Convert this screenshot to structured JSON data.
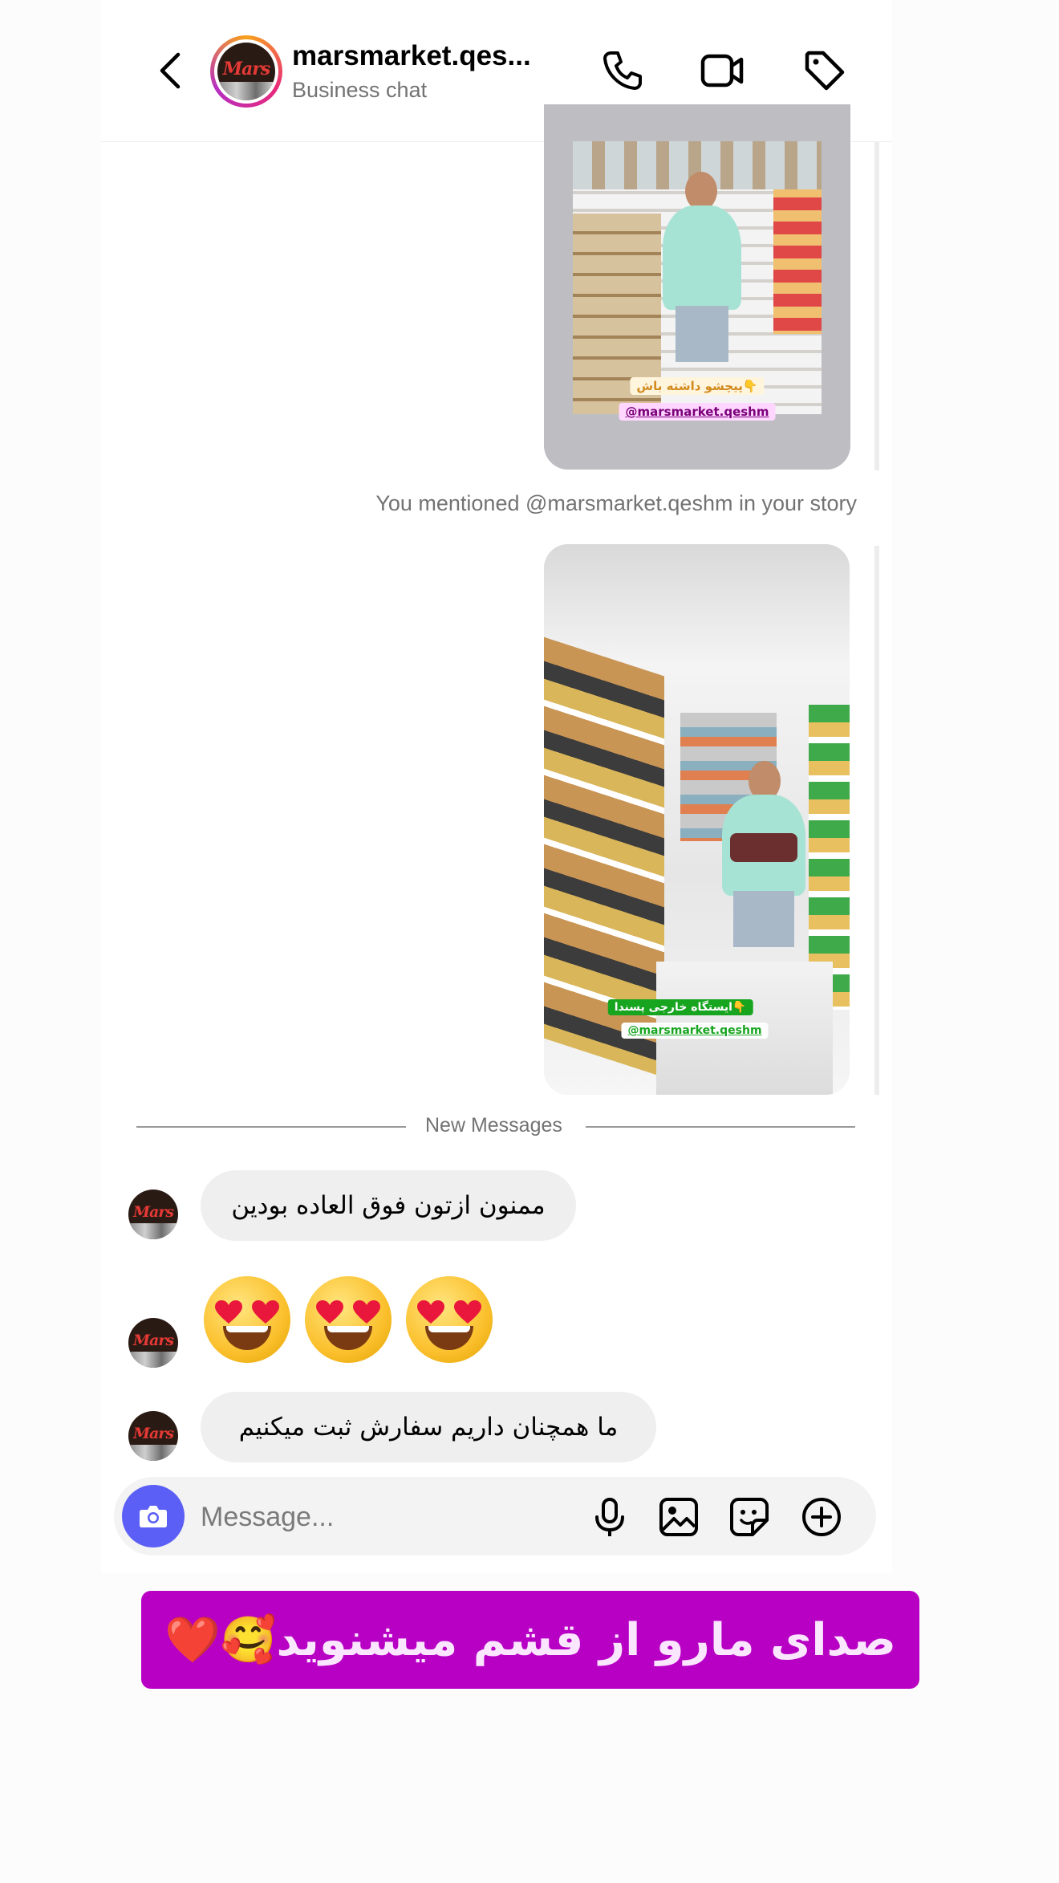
{
  "header": {
    "title": "marsmarket.qes...",
    "subtitle": "Business chat",
    "avatar_logo_text": "Mars"
  },
  "stories": [
    {
      "sticker_text": "پیچشو داشته باش👇",
      "mention_tag": "@marsmarket.qeshm"
    },
    {
      "sticker_text": "👇ایستگاه خارجی پسندا",
      "mention_tag": "@marsmarket.qeshm"
    }
  ],
  "mention_note": "You mentioned @marsmarket.qeshm in your story",
  "divider": {
    "label": "New Messages"
  },
  "messages": [
    {
      "text": "ممنون ازتون فوق العاده بودین"
    },
    {
      "emoji": "😍😍😍"
    },
    {
      "text": "ما همچنان داریم سفارش ثبت میکنیم"
    }
  ],
  "composer": {
    "placeholder": "Message..."
  },
  "banner": {
    "text": "صدای مارو از قشم میشنوید🥰❤️"
  },
  "colors": {
    "accent": "#5b5ff5",
    "banner_bg": "#b800c4",
    "bubble_bg": "#efefef",
    "story_frame": "#bdbdc2"
  },
  "icons": [
    "back-arrow-icon",
    "phone-icon",
    "video-camera-icon",
    "tag-icon",
    "camera-icon",
    "microphone-icon",
    "gallery-icon",
    "sticker-icon",
    "plus-circle-icon"
  ]
}
